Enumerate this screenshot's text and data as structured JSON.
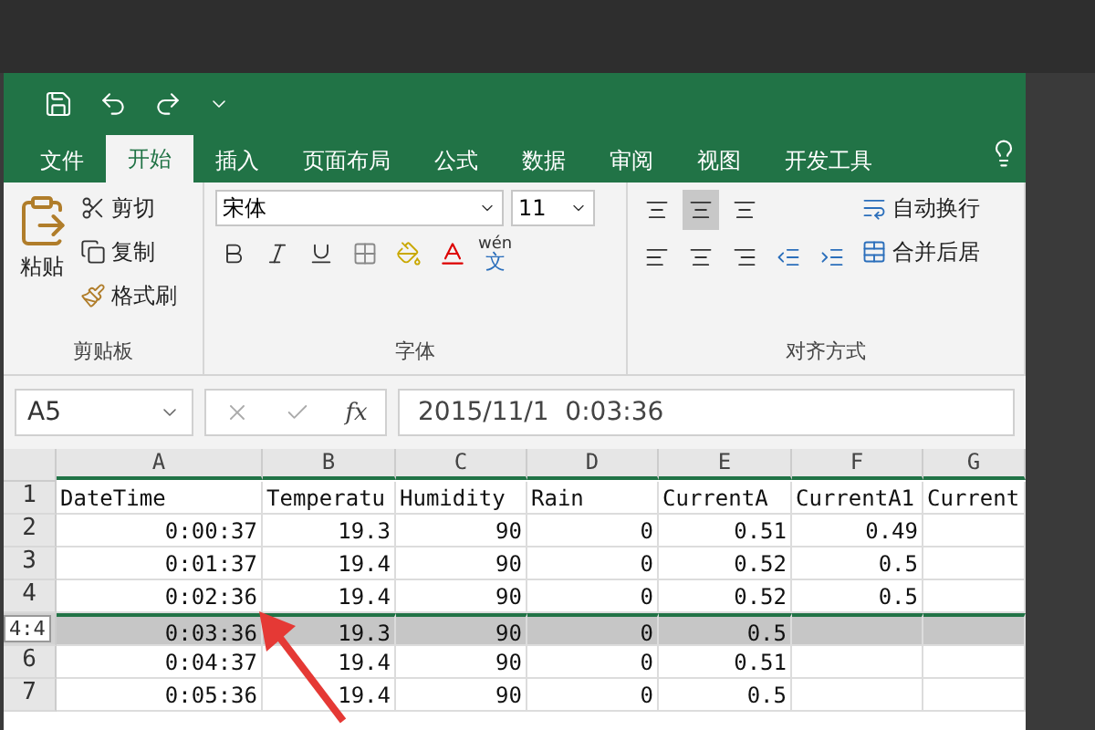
{
  "ribbon_tabs": [
    {
      "label": "文件",
      "selected": false
    },
    {
      "label": "开始",
      "selected": true
    },
    {
      "label": "插入",
      "selected": false
    },
    {
      "label": "页面布局",
      "selected": false
    },
    {
      "label": "公式",
      "selected": false
    },
    {
      "label": "数据",
      "selected": false
    },
    {
      "label": "审阅",
      "selected": false
    },
    {
      "label": "视图",
      "selected": false
    },
    {
      "label": "开发工具",
      "selected": false
    }
  ],
  "clipboard": {
    "paste": "粘贴",
    "cut": "剪切",
    "copy": "复制",
    "format_painter": "格式刷",
    "group": "剪贴板"
  },
  "font": {
    "name": "宋体",
    "size": "11",
    "phonetic": "wén",
    "phonetic_char": "文",
    "group": "字体"
  },
  "alignment": {
    "wrap": "自动换行",
    "merge": "合并后居",
    "group": "对齐方式",
    "middle_selected": true
  },
  "name_box": "A5",
  "formula": "2015/11/1  0:03:36",
  "fx": "fx",
  "columns": [
    "A",
    "B",
    "C",
    "D",
    "E",
    "F",
    "G"
  ],
  "rows": [
    {
      "number": "1",
      "selected": false,
      "cells": [
        "DateTime",
        "Temperatu",
        "Humidity",
        "Rain",
        "CurrentA",
        "CurrentA1",
        "Current"
      ]
    },
    {
      "number": "2",
      "selected": false,
      "cells": [
        "0:00:37",
        "19.3",
        "90",
        "0",
        "0.51",
        "0.49",
        ""
      ]
    },
    {
      "number": "3",
      "selected": false,
      "cells": [
        "0:01:37",
        "19.4",
        "90",
        "0",
        "0.52",
        "0.5",
        ""
      ]
    },
    {
      "number": "4",
      "selected": false,
      "cells": [
        "0:02:36",
        "19.4",
        "90",
        "0",
        "0.52",
        "0.5",
        ""
      ]
    },
    {
      "selected": true,
      "cells": [
        "0:03:36",
        "19.3",
        "90",
        "0",
        "0.5",
        "",
        ""
      ]
    },
    {
      "number": "6",
      "selected": false,
      "cells": [
        "0:04:37",
        "19.4",
        "90",
        "0",
        "0.51",
        "",
        ""
      ]
    },
    {
      "number": "7",
      "selected": false,
      "cells": [
        "0:05:36",
        "19.4",
        "90",
        "0",
        "0.5",
        "",
        ""
      ]
    }
  ],
  "row_tooltip": "4:4"
}
